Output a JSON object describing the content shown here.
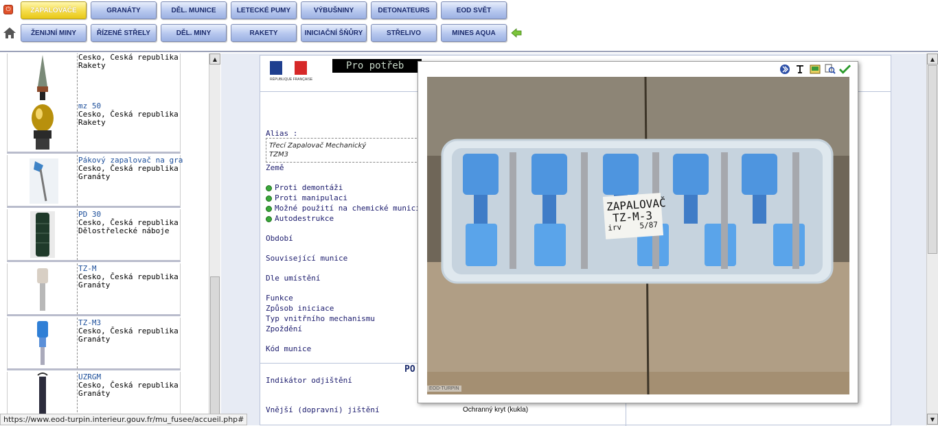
{
  "nav": {
    "row1": [
      "ZAPALOVAČE",
      "GRANÁTY",
      "DĚL. MUNICE",
      "LETECKÉ PUMY",
      "VÝBUŠNINY",
      "DETONATEURS",
      "EOD SVĚT"
    ],
    "row2": [
      "ŽENIJNÍ MINY",
      "ŘÍZENÉ STŘELY",
      "DĚL. MINY",
      "RAKETY",
      "INICIAČNÍ ŠŇŮRY",
      "STŘELIVO",
      "MINES AQUA"
    ],
    "active": "ZAPALOVAČE"
  },
  "list": [
    {
      "name": "",
      "line1": "Cesko, Česká republika",
      "line2": "Rakety"
    },
    {
      "name": "mz 50",
      "line1": "Cesko, Česká republika",
      "line2": "Rakety"
    },
    {
      "name": "Pákový zapalovač na gra",
      "line1": "Cesko, Česká republika",
      "line2": "Granáty"
    },
    {
      "name": "PD 30",
      "line1": "Cesko, Česká republika",
      "line2": "Dělostřelecké náboje"
    },
    {
      "name": "TZ-M",
      "line1": "Cesko, Česká republika",
      "line2": "Granáty"
    },
    {
      "name": "TZ-M3",
      "line1": "Cesko, Česká republika",
      "line2": "Granáty"
    },
    {
      "name": "UZRGM",
      "line1": "Cesko, Česká republika",
      "line2": "Granáty"
    }
  ],
  "detail": {
    "banner": "Pro potřeb",
    "republique": "RÉPUBLIQUE FRANÇAISE",
    "alias_label": "Alias :",
    "alias_values": [
      "Třecí Zapalovač Mechanický",
      "TZM3"
    ],
    "zeme_label": "Země",
    "flags": [
      "Proti demontáži",
      "Proti manipulaci",
      "Možné použití na chemické munici",
      "Autodestrukce"
    ],
    "fields": [
      "Období",
      "Související munice",
      "Dle umístění",
      "Funkce",
      "Způsob iniciace",
      "Typ vnitřního mechanismu",
      "Zpoždění",
      "Kód munice"
    ],
    "section_heading": "PO",
    "indicator_label": "Indikátor odjištění",
    "external_label": "Vnější (dopravní) jištění",
    "external_value": "Ochranný kryt (kukla)"
  },
  "popup": {
    "photo_label_line1": "ZAPALOVAČ",
    "photo_label_line2": "TZ-M-3",
    "photo_label_line3": "irv",
    "photo_label_line4": "5/87",
    "watermark": "EOD-TURPIN"
  },
  "status": "https://www.eod-turpin.interieur.gouv.fr/mu_fusee/accueil.php#",
  "colors": {
    "nav_blue": "#9cb1e3",
    "nav_active": "#f5dc4a",
    "link": "#1c4e9a",
    "ok_green": "#3aa83a"
  }
}
